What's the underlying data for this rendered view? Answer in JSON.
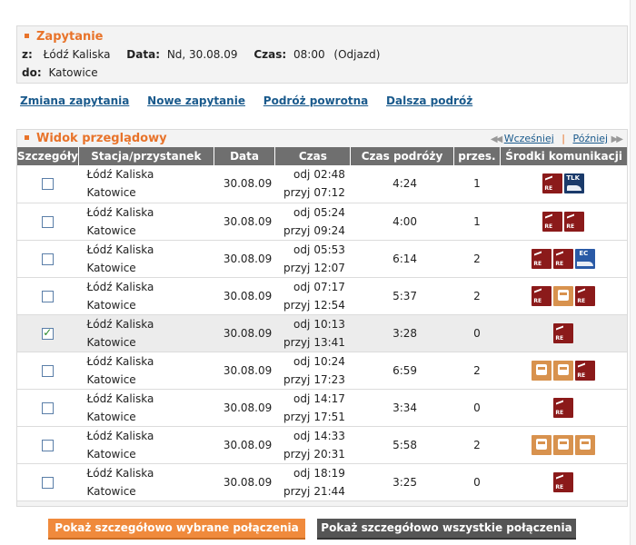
{
  "query": {
    "title": "Zapytanie",
    "from_label": "z:",
    "from_value": "Łódź Kaliska",
    "date_label": "Data:",
    "date_value": "Nd, 30.08.09",
    "time_label": "Czas:",
    "time_value": "08:00",
    "time_mode": "(Odjazd)",
    "to_label": "do:",
    "to_value": "Katowice"
  },
  "links": [
    "Zmiana zapytania",
    "Nowe zapytanie",
    "Podróż powrotna",
    "Dalsza podróż"
  ],
  "overview": {
    "title": "Widok przeglądowy",
    "earlier": "Wcześniej",
    "later": "Później",
    "columns": [
      "Szczegóły",
      "Stacja/przystanek",
      "Data",
      "Czas",
      "Czas podróży",
      "przes.",
      "Środki komunikacji"
    ],
    "dep_label": "odj",
    "arr_label": "przyj",
    "rows": [
      {
        "from": "Łódź Kaliska",
        "to": "Katowice",
        "date": "30.08.09",
        "dep": "02:48",
        "arr": "07:12",
        "dur": "4:24",
        "chg": "1",
        "checked": false,
        "modes": [
          "reg",
          "tlk"
        ]
      },
      {
        "from": "Łódź Kaliska",
        "to": "Katowice",
        "date": "30.08.09",
        "dep": "05:24",
        "arr": "09:24",
        "dur": "4:00",
        "chg": "1",
        "checked": false,
        "modes": [
          "reg",
          "reg"
        ]
      },
      {
        "from": "Łódź Kaliska",
        "to": "Katowice",
        "date": "30.08.09",
        "dep": "05:53",
        "arr": "12:07",
        "dur": "6:14",
        "chg": "2",
        "checked": false,
        "modes": [
          "reg",
          "reg",
          "ec"
        ]
      },
      {
        "from": "Łódź Kaliska",
        "to": "Katowice",
        "date": "30.08.09",
        "dep": "07:17",
        "arr": "12:54",
        "dur": "5:37",
        "chg": "2",
        "checked": false,
        "modes": [
          "reg",
          "bus",
          "reg"
        ]
      },
      {
        "from": "Łódź Kaliska",
        "to": "Katowice",
        "date": "30.08.09",
        "dep": "10:13",
        "arr": "13:41",
        "dur": "3:28",
        "chg": "0",
        "checked": true,
        "modes": [
          "reg"
        ]
      },
      {
        "from": "Łódź Kaliska",
        "to": "Katowice",
        "date": "30.08.09",
        "dep": "10:24",
        "arr": "17:23",
        "dur": "6:59",
        "chg": "2",
        "checked": false,
        "modes": [
          "bus",
          "bus",
          "reg"
        ]
      },
      {
        "from": "Łódź Kaliska",
        "to": "Katowice",
        "date": "30.08.09",
        "dep": "14:17",
        "arr": "17:51",
        "dur": "3:34",
        "chg": "0",
        "checked": false,
        "modes": [
          "reg"
        ]
      },
      {
        "from": "Łódź Kaliska",
        "to": "Katowice",
        "date": "30.08.09",
        "dep": "14:33",
        "arr": "20:31",
        "dur": "5:58",
        "chg": "2",
        "checked": false,
        "modes": [
          "bus",
          "bus",
          "bus"
        ]
      },
      {
        "from": "Łódź Kaliska",
        "to": "Katowice",
        "date": "30.08.09",
        "dep": "18:19",
        "arr": "21:44",
        "dur": "3:25",
        "chg": "0",
        "checked": false,
        "modes": [
          "reg"
        ]
      }
    ]
  },
  "buttons": {
    "selected": "Pokaż szczegółowo wybrane połączenia",
    "all": "Pokaż szczegółowo wszystkie połączenia"
  },
  "colors": {
    "accent": "#e8732a",
    "header_bg": "#6f6f6f",
    "link": "#1a5a8c"
  },
  "icons": {
    "reg": "regional-train-icon",
    "tlk": "tlk-train-icon",
    "ec": "ec-train-icon",
    "bus": "bus-icon"
  }
}
